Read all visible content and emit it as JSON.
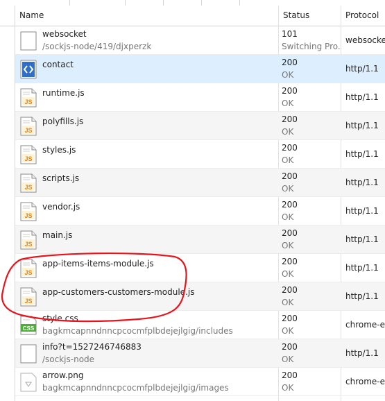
{
  "columns": {
    "name": "Name",
    "status": "Status",
    "protocol": "Protocol"
  },
  "rows": [
    {
      "name": "websocket",
      "path": "/sockjs-node/419/djxperzk",
      "status": "101",
      "status_text": "Switching Pro...",
      "protocol": "websocket",
      "icon": "generic-file-icon"
    },
    {
      "name": "contact",
      "path": "",
      "status": "200",
      "status_text": "OK",
      "protocol": "http/1.1",
      "icon": "html-file-icon"
    },
    {
      "name": "runtime.js",
      "path": "",
      "status": "200",
      "status_text": "OK",
      "protocol": "http/1.1",
      "icon": "js-file-icon"
    },
    {
      "name": "polyfills.js",
      "path": "",
      "status": "200",
      "status_text": "OK",
      "protocol": "http/1.1",
      "icon": "js-file-icon"
    },
    {
      "name": "styles.js",
      "path": "",
      "status": "200",
      "status_text": "OK",
      "protocol": "http/1.1",
      "icon": "js-file-icon"
    },
    {
      "name": "scripts.js",
      "path": "",
      "status": "200",
      "status_text": "OK",
      "protocol": "http/1.1",
      "icon": "js-file-icon"
    },
    {
      "name": "vendor.js",
      "path": "",
      "status": "200",
      "status_text": "OK",
      "protocol": "http/1.1",
      "icon": "js-file-icon"
    },
    {
      "name": "main.js",
      "path": "",
      "status": "200",
      "status_text": "OK",
      "protocol": "http/1.1",
      "icon": "js-file-icon"
    },
    {
      "name": "app-items-items-module.js",
      "path": "",
      "status": "200",
      "status_text": "OK",
      "protocol": "http/1.1",
      "icon": "js-file-icon"
    },
    {
      "name": "app-customers-customers-module.js",
      "path": "",
      "status": "200",
      "status_text": "OK",
      "protocol": "http/1.1",
      "icon": "js-file-icon"
    },
    {
      "name": "style.css",
      "path": "bagkmcapnndnncpcocmfplbdejejlgig/includes",
      "status": "200",
      "status_text": "OK",
      "protocol": "chrome-ex",
      "icon": "css-file-icon"
    },
    {
      "name": "info?t=1527246746883",
      "path": "/sockjs-node",
      "status": "200",
      "status_text": "OK",
      "protocol": "http/1.1",
      "icon": "generic-file-icon"
    },
    {
      "name": "arrow.png",
      "path": "bagkmcapnndnncpcocmfplbdejejlgig/images",
      "status": "200",
      "status_text": "OK",
      "protocol": "chrome-ex",
      "icon": "image-file-icon"
    }
  ],
  "selected_row": "contact",
  "colors": {
    "selected": "#ddeeff",
    "alt_row": "#f5f5f5",
    "annotation": "#e8141c"
  }
}
